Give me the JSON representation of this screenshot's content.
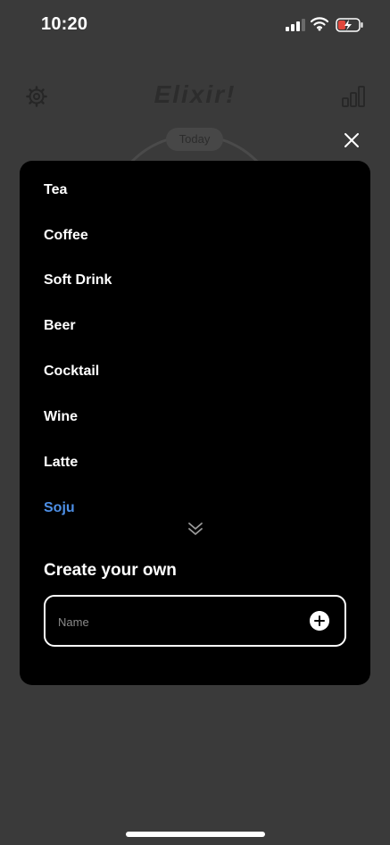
{
  "status_bar": {
    "time": "10:20",
    "icons": [
      "signal-icon",
      "wifi-icon",
      "battery-charging-icon"
    ]
  },
  "background_app": {
    "title": "Elixir!",
    "today_label": "Today",
    "icons": [
      "gear-icon",
      "bar-chart-icon"
    ]
  },
  "sheet": {
    "drinks": [
      "Tea",
      "Coffee",
      "Soft Drink",
      "Beer",
      "Cocktail",
      "Wine",
      "Latte",
      "Soju"
    ],
    "selected_drink": "Soju",
    "more_icon": "double-chevron-down-icon",
    "create_title": "Create your own",
    "name_input": {
      "placeholder": "Name",
      "value": ""
    },
    "add_icon": "plus-circle-icon",
    "close_icon": "close-icon"
  },
  "colors": {
    "background": "#3a3a3a",
    "sheet": "#000000",
    "selected": "#4d8fe6",
    "text": "#ffffff"
  }
}
